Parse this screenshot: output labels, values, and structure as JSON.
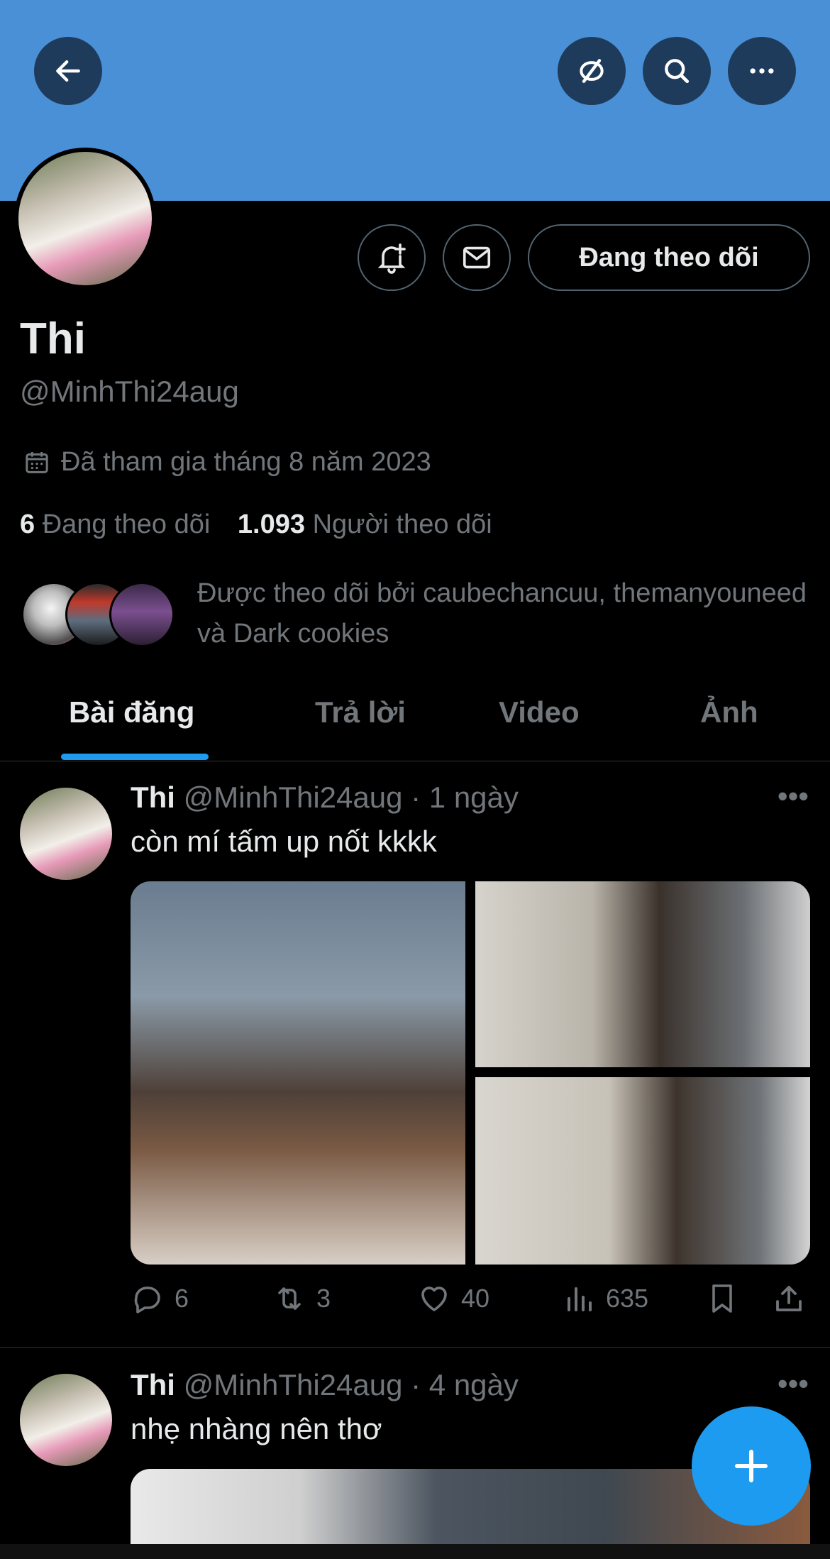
{
  "profile": {
    "name": "Thi",
    "handle": "@MinhThi24aug",
    "joined": "Đã tham gia tháng 8 năm 2023",
    "following_count": "6",
    "following_label": "Đang theo dõi",
    "followers_count": "1.093",
    "followers_label": "Người theo dõi",
    "followed_by": "Được theo dõi bởi caubechancuu, themanyouneed và Dark cookies",
    "follow_button": "Đang theo dõi"
  },
  "tabs": [
    {
      "label": "Bài đăng",
      "active": true
    },
    {
      "label": "Trả lời",
      "active": false
    },
    {
      "label": "Video",
      "active": false
    },
    {
      "label": "Ảnh",
      "active": false
    }
  ],
  "posts": [
    {
      "name": "Thi",
      "handle": "@MinhThi24aug",
      "time": "· 1 ngày",
      "text": "còn mí tấm up nốt kkkk",
      "replies": "6",
      "reposts": "3",
      "likes": "40",
      "views": "635"
    },
    {
      "name": "Thi",
      "handle": "@MinhThi24aug",
      "time": "· 4 ngày",
      "text": "nhẹ nhàng nên thơ"
    }
  ],
  "colors": {
    "banner": "#4a90d6",
    "accent": "#1d9bf0",
    "muted": "#71767b"
  },
  "icons": {
    "back": "arrow-left-icon",
    "hide": "eye-slash-icon",
    "search": "search-icon",
    "more": "more-horizontal-icon",
    "notify": "bell-plus-icon",
    "message": "envelope-icon",
    "calendar": "calendar-icon",
    "compose": "plus-icon"
  }
}
